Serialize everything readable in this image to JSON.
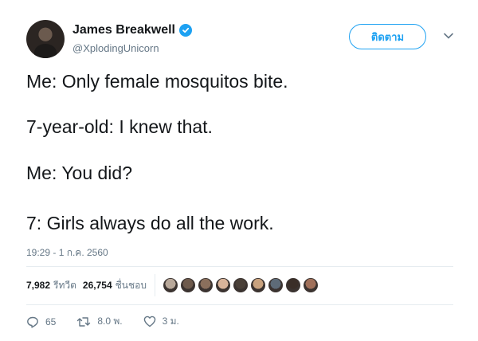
{
  "author": {
    "display_name": "James Breakwell",
    "handle": "@XplodingUnicorn",
    "verified_icon": "verified-badge-icon"
  },
  "follow_button_label": "ติดตาม",
  "tweet": {
    "lines": [
      "Me: Only female mosquitos bite.",
      "7-year-old: I knew that.",
      "Me: You did?",
      "7: Girls always do all the work."
    ],
    "timestamp": "19:29 - 1 ก.ค. 2560"
  },
  "stats": {
    "retweets_count": "7,982",
    "retweets_label": "รีทวีต",
    "likes_count": "26,754",
    "likes_label": "ชื่นชอบ"
  },
  "liker_avatars": [
    "#b8a89a",
    "#6e5a4c",
    "#8a6f5c",
    "#d9b49a",
    "#4a4038",
    "#c9a27e",
    "#5e6b78",
    "#3a2e28",
    "#a0705a"
  ],
  "actions": {
    "reply_count": "65",
    "retweet_count": "8.0 พ.",
    "like_count": "3 ม."
  },
  "colors": {
    "accent": "#1da1f2",
    "secondary_text": "#657786",
    "divider": "#e6ecf0"
  }
}
